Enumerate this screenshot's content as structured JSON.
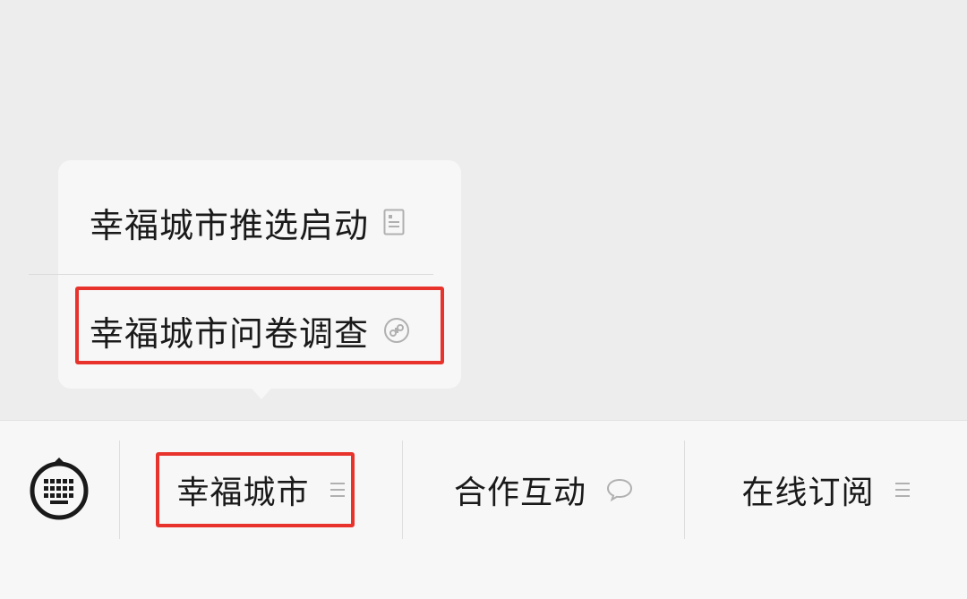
{
  "popup": {
    "items": [
      {
        "label": "幸福城市推选启动",
        "icon": "article-icon"
      },
      {
        "label": "幸福城市问卷调查",
        "icon": "mini-program-icon"
      }
    ]
  },
  "menu_bar": {
    "keyboard_icon": "keyboard-icon",
    "items": [
      {
        "label": "幸福城市",
        "icon": "submenu-lines-icon"
      },
      {
        "label": "合作互动",
        "icon": "message-bubble-icon"
      },
      {
        "label": "在线订阅",
        "icon": "submenu-lines-icon"
      }
    ]
  },
  "colors": {
    "background": "#ededed",
    "panel": "#f7f7f7",
    "highlight_box": "#e8332d",
    "icon_gray": "#b0b0b0"
  }
}
